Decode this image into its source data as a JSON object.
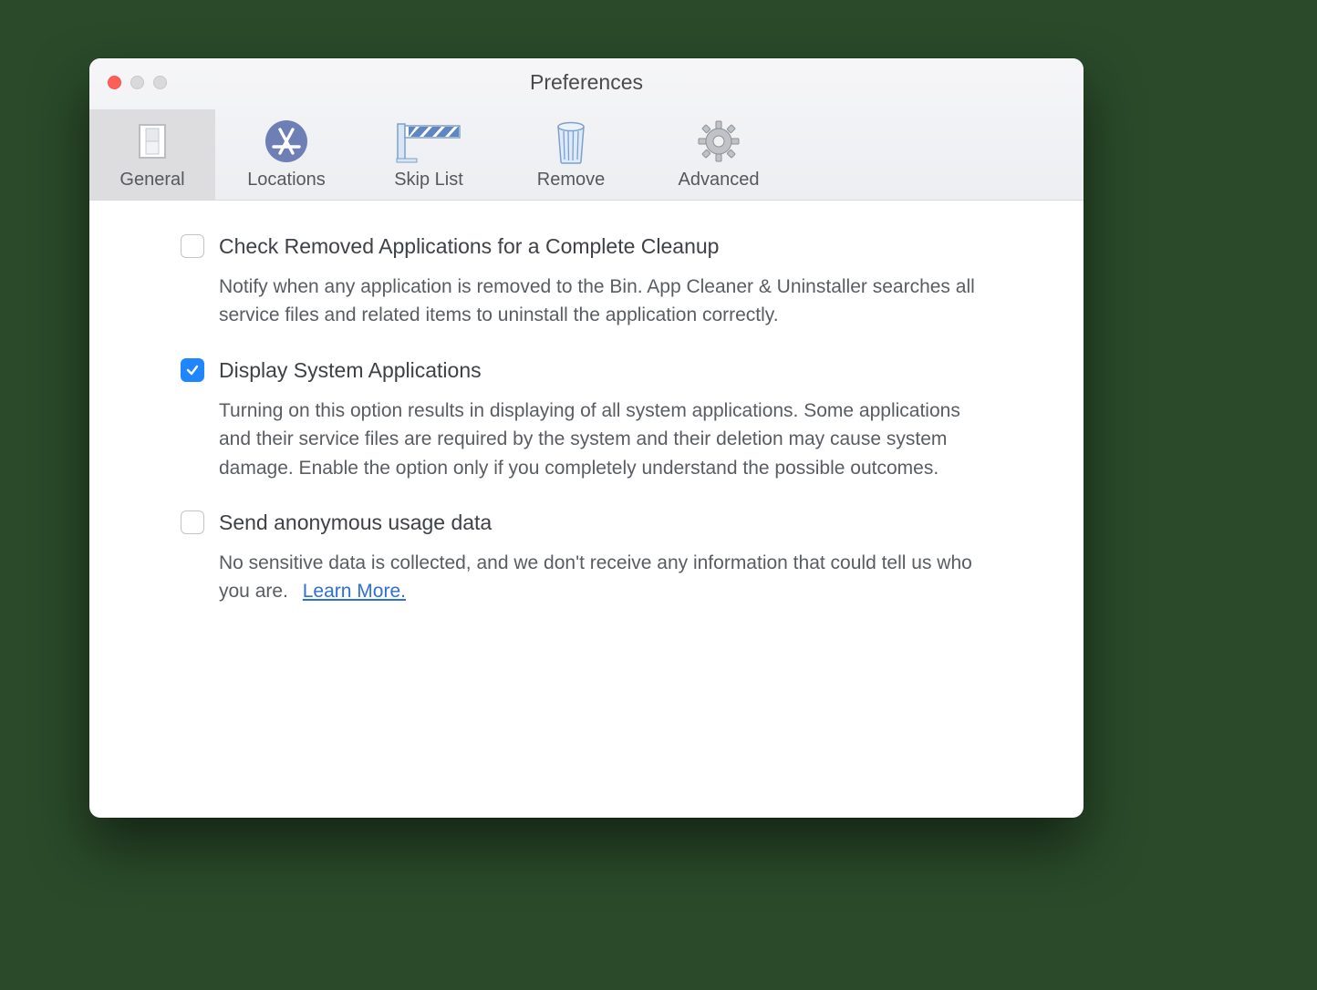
{
  "window": {
    "title": "Preferences"
  },
  "tabs": {
    "general": {
      "label": "General"
    },
    "locations": {
      "label": "Locations"
    },
    "skiplist": {
      "label": "Skip List"
    },
    "remove": {
      "label": "Remove"
    },
    "advanced": {
      "label": "Advanced"
    }
  },
  "options": {
    "cleanup": {
      "checked": false,
      "title": "Check Removed Applications for a Complete Cleanup",
      "desc": "Notify when any application is removed to the Bin. App Cleaner & Uninstaller searches all service files and related items to uninstall the application correctly."
    },
    "systemapps": {
      "checked": true,
      "title": "Display System Applications",
      "desc": "Turning on this option results in displaying of all system applications. Some applications and their service files are required by the system and their deletion may cause system damage. Enable the option only if you completely understand the possible outcomes."
    },
    "usage": {
      "checked": false,
      "title": "Send anonymous usage data",
      "desc": "No sensitive data is collected, and we don't receive any information that could tell us who you are.",
      "learn_more": "Learn More."
    }
  }
}
